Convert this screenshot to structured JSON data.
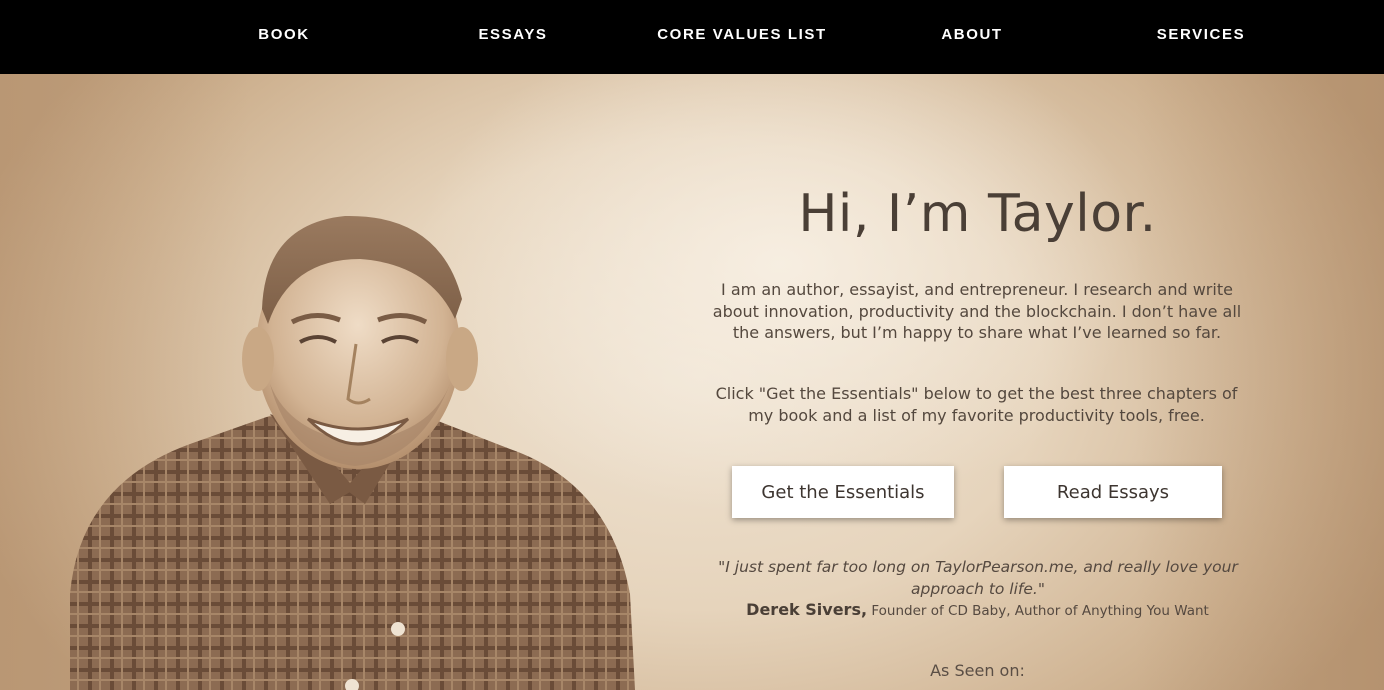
{
  "nav": {
    "items": [
      "BOOK",
      "ESSAYS",
      "CORE VALUES LIST",
      "ABOUT",
      "SERVICES"
    ]
  },
  "hero": {
    "headline": "Hi, I’m Taylor.",
    "intro": "I am an author, essayist, and entrepreneur. I research and write about innovation, productivity and the blockchain. I don’t have all the answers, but I’m happy to share what I’ve learned so far.",
    "cta_text": "Click \"Get the Essentials\" below to get the best three chapters of my book and a list of my favorite productivity tools, free.",
    "buttons": {
      "primary": "Get the Essentials",
      "secondary": "Read Essays"
    },
    "testimonial": {
      "quote": "\"I just spent far too long on TaylorPearson.me, and really love your approach to life.\"",
      "name": "Derek Sivers,",
      "title": "Founder of CD Baby, Author of Anything You Want"
    },
    "as_seen_on": "As Seen on:"
  },
  "colors": {
    "nav_bg": "#000000",
    "nav_text": "#ffffff",
    "hero_bg": "#e6d4bc",
    "text": "#4a3f36",
    "button_bg": "#ffffff"
  }
}
